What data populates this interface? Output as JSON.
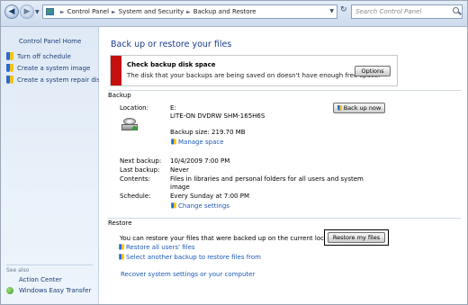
{
  "address_bar": {
    "crumbs": [
      "Control Panel",
      "System and Security",
      "Backup and Restore"
    ],
    "search_placeholder": "Search Control Panel"
  },
  "sidebar": {
    "home": "Control Panel Home",
    "items": [
      {
        "label": "Turn off schedule",
        "icon": "shield-icon"
      },
      {
        "label": "Create a system image",
        "icon": "shield-icon"
      },
      {
        "label": "Create a system repair disc",
        "icon": "shield-icon"
      }
    ],
    "see_also": "See also",
    "see_also_items": [
      "Action Center",
      "Windows Easy Transfer"
    ]
  },
  "main": {
    "title": "Back up or restore your files",
    "alert": {
      "heading": "Check backup disk space",
      "message": "The disk that your backups are being saved on doesn't have enough free space.",
      "button": "Options"
    },
    "backup": {
      "section": "Backup",
      "location_label": "Location:",
      "location_drive": "E:",
      "location_device": "LITE-ON DVDRW SHM-165H6S",
      "backup_now": "Back up now",
      "backup_size": "Backup size: 219.70 MB",
      "manage_space": "Manage space",
      "next_backup_label": "Next backup:",
      "next_backup": "10/4/2009 7:00 PM",
      "last_backup_label": "Last backup:",
      "last_backup": "Never",
      "contents_label": "Contents:",
      "contents_line1": "Files in libraries and personal folders for all users and system",
      "contents_line2": "image",
      "schedule_label": "Schedule:",
      "schedule": "Every Sunday at 7:00 PM",
      "change_settings": "Change settings"
    },
    "restore": {
      "section": "Restore",
      "message": "You can restore your files that were backed up on the current location.",
      "restore_my_files": "Restore my files",
      "restore_all_users": "Restore all users' files",
      "select_another": "Select another backup to restore files from",
      "recover_system": "Recover system settings or your computer"
    }
  }
}
